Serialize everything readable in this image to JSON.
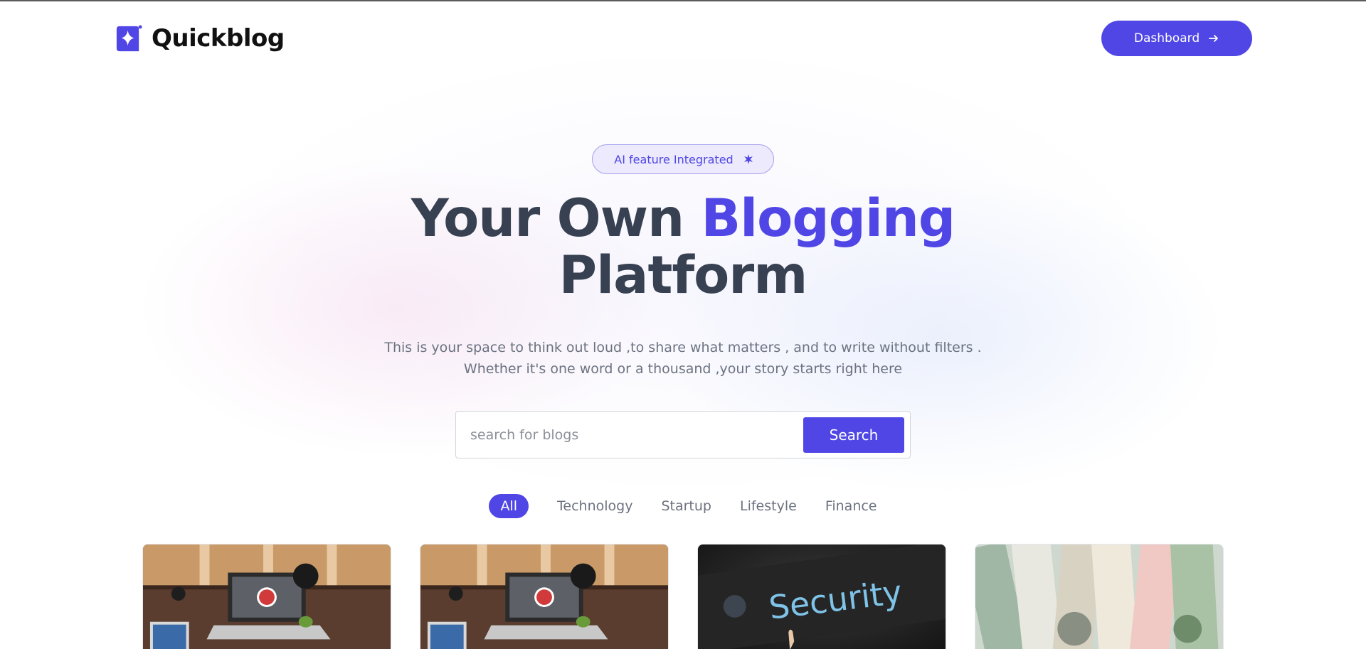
{
  "header": {
    "brand": "Quickblog",
    "dashboard_label": "Dashboard"
  },
  "hero": {
    "badge": "AI feature Integrated",
    "title_part1": "Your Own ",
    "title_accent": "Blogging",
    "title_part2": "Platform",
    "subtitle": "This is your space to think out loud ,to share what matters , and to write without filters . Whether it's one word or a thousand ,your story starts right here"
  },
  "search": {
    "placeholder": "search for blogs",
    "value": "",
    "button_label": "Search"
  },
  "categories": [
    {
      "label": "All",
      "active": true
    },
    {
      "label": "Technology",
      "active": false
    },
    {
      "label": "Startup",
      "active": false
    },
    {
      "label": "Lifestyle",
      "active": false
    },
    {
      "label": "Finance",
      "active": false
    }
  ],
  "cards": [
    {
      "image": "desk-workspace-photo"
    },
    {
      "image": "desk-workspace-photo"
    },
    {
      "image": "security-keyboard-photo",
      "image_text": "Security"
    },
    {
      "image": "money-rolls-photo"
    }
  ],
  "colors": {
    "accent": "#4f46e5",
    "heading": "#374151",
    "muted": "#6b7280"
  }
}
